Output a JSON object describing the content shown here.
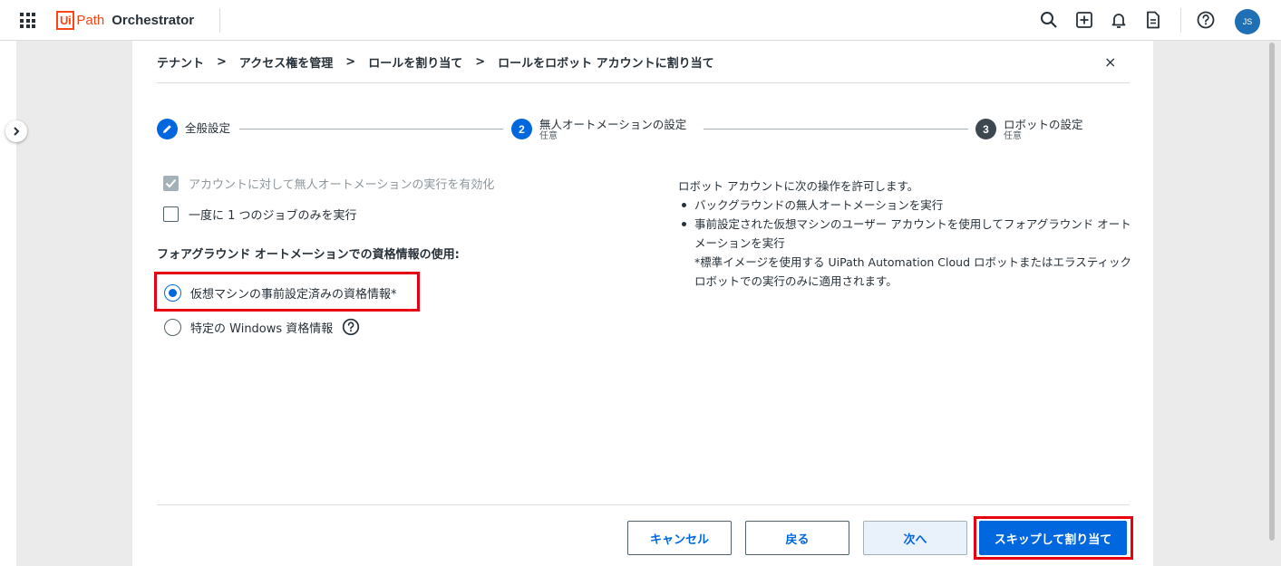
{
  "header": {
    "brand_box": "Ui",
    "brand_path": "Path",
    "product": "Orchestrator",
    "avatar_initials": "JS",
    "icons": [
      "apps-grid-icon",
      "search-icon",
      "add-icon",
      "bell-icon",
      "document-icon",
      "help-icon"
    ]
  },
  "breadcrumb": {
    "items": [
      "テナント",
      "アクセス権を管理",
      "ロールを割り当て",
      "ロールをロボット アカウントに割り当て"
    ],
    "separator": ">"
  },
  "close_label": "×",
  "stepper": {
    "steps": [
      {
        "label": "全般設定",
        "sub": "",
        "marker": "edit-icon",
        "state": "active"
      },
      {
        "label": "無人オートメーションの設定",
        "sub": "任意",
        "marker": "2",
        "state": "current"
      },
      {
        "label": "ロボットの設定",
        "sub": "任意",
        "marker": "3",
        "state": "pending"
      }
    ]
  },
  "form": {
    "checkbox_unattended": {
      "label": "アカウントに対して無人オートメーションの実行を有効化",
      "checked": true,
      "disabled": true
    },
    "checkbox_one_job": {
      "label": "一度に 1 つのジョブのみを実行",
      "checked": false
    },
    "credentials_label": "フォアグラウンド オートメーションでの資格情報の使用:",
    "radio_vm": {
      "label": "仮想マシンの事前設定済みの資格情報*",
      "selected": true
    },
    "radio_windows": {
      "label": "特定の Windows 資格情報",
      "selected": false
    }
  },
  "info": {
    "intro": "ロボット アカウントに次の操作を許可します。",
    "bullets": [
      "バックグラウンドの無人オートメーションを実行",
      "事前設定された仮想マシンのユーザー アカウントを使用してフォアグラウンド オートメーションを実行"
    ],
    "note": "*標準イメージを使用する UiPath Automation Cloud ロボットまたはエラスティック ロボットでの実行のみに適用されます。"
  },
  "footer": {
    "cancel": "キャンセル",
    "back": "戻る",
    "next": "次へ",
    "skip_assign": "スキップして割り当て"
  },
  "colors": {
    "accent": "#0067df",
    "highlight": "#e60012",
    "brand": "#fa4616"
  }
}
